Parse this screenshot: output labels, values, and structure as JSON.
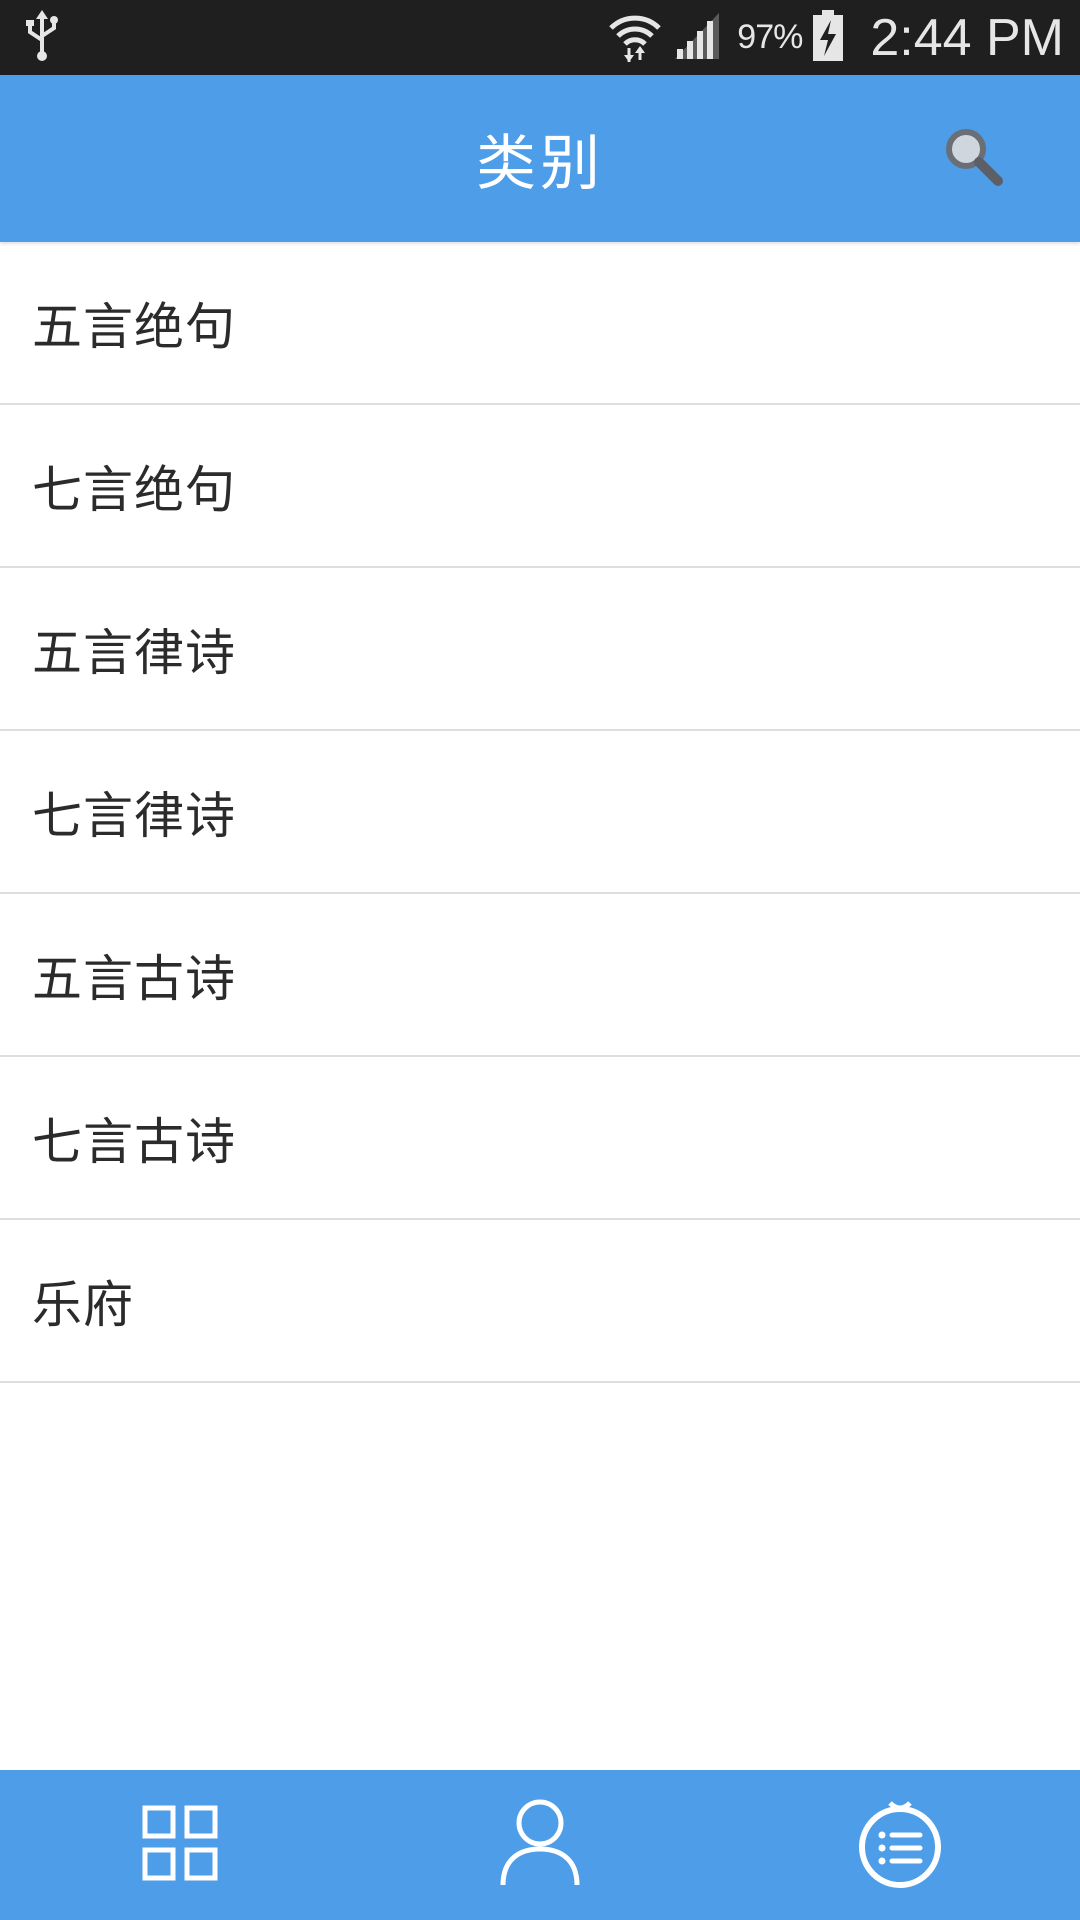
{
  "status_bar": {
    "usb_icon": "usb-icon",
    "wifi_icon": "wifi-icon",
    "signal_icon": "cell-signal-icon",
    "battery_percent": "97%",
    "battery_icon": "battery-charging-icon",
    "time": "2:44 PM"
  },
  "header": {
    "title": "类别",
    "search_icon": "search-icon"
  },
  "categories": [
    {
      "label": "五言绝句"
    },
    {
      "label": "七言绝句"
    },
    {
      "label": "五言律诗"
    },
    {
      "label": "七言律诗"
    },
    {
      "label": "五言古诗"
    },
    {
      "label": "七言古诗"
    },
    {
      "label": "乐府"
    }
  ],
  "bottom_nav": [
    {
      "icon": "grid-icon"
    },
    {
      "icon": "user-icon"
    },
    {
      "icon": "list-icon"
    }
  ],
  "colors": {
    "primary": "#4d9de8",
    "status_bar": "#1f1f1f",
    "divider": "#dedede",
    "text": "#2b2b2b"
  }
}
